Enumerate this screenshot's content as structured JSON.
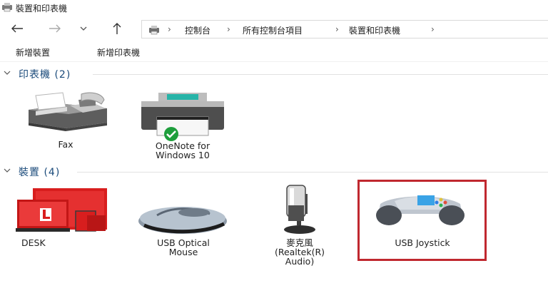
{
  "window": {
    "title": "裝置和印表機"
  },
  "address_bar": {
    "items": [
      "控制台",
      "所有控制台項目",
      "裝置和印表機"
    ]
  },
  "toolbar": {
    "add_device": "新增裝置",
    "add_printer": "新增印表機"
  },
  "groups": {
    "printers": {
      "header": "印表機 (2)",
      "items": [
        {
          "label": "Fax"
        },
        {
          "label_line1": "OneNote for",
          "label_line2": "Windows 10",
          "status": "default-printer"
        }
      ]
    },
    "devices": {
      "header": "裝置 (4)",
      "items": [
        {
          "label": "DESK"
        },
        {
          "label_line1": "USB Optical",
          "label_line2": "Mouse"
        },
        {
          "label_line1": "麥克風",
          "label_line2": "(Realtek(R)",
          "label_line3": "Audio)"
        },
        {
          "label": "USB Joystick",
          "highlighted": true
        }
      ]
    }
  },
  "colors": {
    "accent": "#1a4a7a",
    "highlight_border": "#c0282f",
    "check_green": "#1e9e3c",
    "desk_red": "#d81e1e"
  }
}
